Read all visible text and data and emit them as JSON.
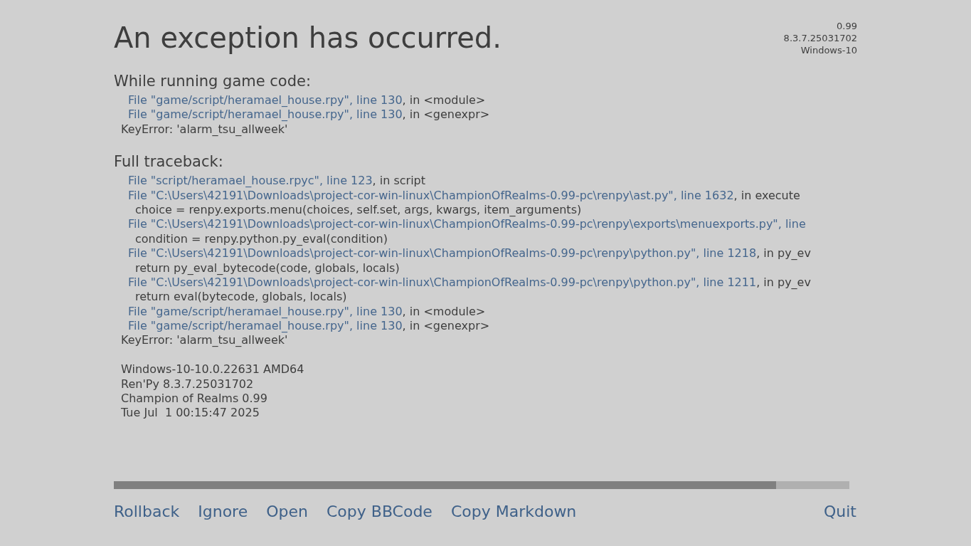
{
  "title": "An exception has occurred.",
  "version_info": [
    "0.99",
    "8.3.7.25031702",
    "Windows-10"
  ],
  "sections": [
    {
      "heading": "While running game code:",
      "lines": [
        {
          "kind": "file",
          "link": "File \"game/script/heramael_house.rpy\", line 130",
          "rest": ", in <module>"
        },
        {
          "kind": "file",
          "link": "File \"game/script/heramael_house.rpy\", line 130",
          "rest": ", in <genexpr>"
        },
        {
          "kind": "error",
          "text": "KeyError: 'alarm_tsu_allweek'"
        }
      ]
    },
    {
      "heading": "Full traceback:",
      "lines": [
        {
          "kind": "file",
          "link": "File \"script/heramael_house.rpyc\", line 123",
          "rest": ", in script"
        },
        {
          "kind": "file",
          "link": "File \"C:\\Users\\42191\\Downloads\\project-cor-win-linux\\ChampionOfRealms-0.99-pc\\renpy\\ast.py\", line 1632",
          "rest": ", in execute"
        },
        {
          "kind": "code",
          "text": "choice = renpy.exports.menu(choices, self.set, args, kwargs, item_arguments)"
        },
        {
          "kind": "file",
          "link": "File \"C:\\Users\\42191\\Downloads\\project-cor-win-linux\\ChampionOfRealms-0.99-pc\\renpy\\exports\\menuexports.py\", line"
        },
        {
          "kind": "code",
          "text": "condition = renpy.python.py_eval(condition)"
        },
        {
          "kind": "file",
          "link": "File \"C:\\Users\\42191\\Downloads\\project-cor-win-linux\\ChampionOfRealms-0.99-pc\\renpy\\python.py\", line 1218",
          "rest": ", in py_ev"
        },
        {
          "kind": "code",
          "text": "return py_eval_bytecode(code, globals, locals)"
        },
        {
          "kind": "file",
          "link": "File \"C:\\Users\\42191\\Downloads\\project-cor-win-linux\\ChampionOfRealms-0.99-pc\\renpy\\python.py\", line 1211",
          "rest": ", in py_ev"
        },
        {
          "kind": "code",
          "text": "return eval(bytecode, globals, locals)"
        },
        {
          "kind": "file",
          "link": "File \"game/script/heramael_house.rpy\", line 130",
          "rest": ", in <module>"
        },
        {
          "kind": "file",
          "link": "File \"game/script/heramael_house.rpy\", line 130",
          "rest": ", in <genexpr>"
        },
        {
          "kind": "error",
          "text": "KeyError: 'alarm_tsu_allweek'"
        },
        {
          "kind": "gap"
        },
        {
          "kind": "error",
          "text": "Windows-10-10.0.22631 AMD64"
        },
        {
          "kind": "error",
          "text": "Ren'Py 8.3.7.25031702"
        },
        {
          "kind": "error",
          "text": "Champion of Realms 0.99"
        },
        {
          "kind": "error",
          "text": "Tue Jul  1 00:15:47 2025"
        }
      ]
    }
  ],
  "scrollbar": {
    "level": 0.9
  },
  "actions": [
    "Rollback",
    "Ignore",
    "Open",
    "Copy BBCode",
    "Copy Markdown"
  ],
  "quit": "Quit"
}
